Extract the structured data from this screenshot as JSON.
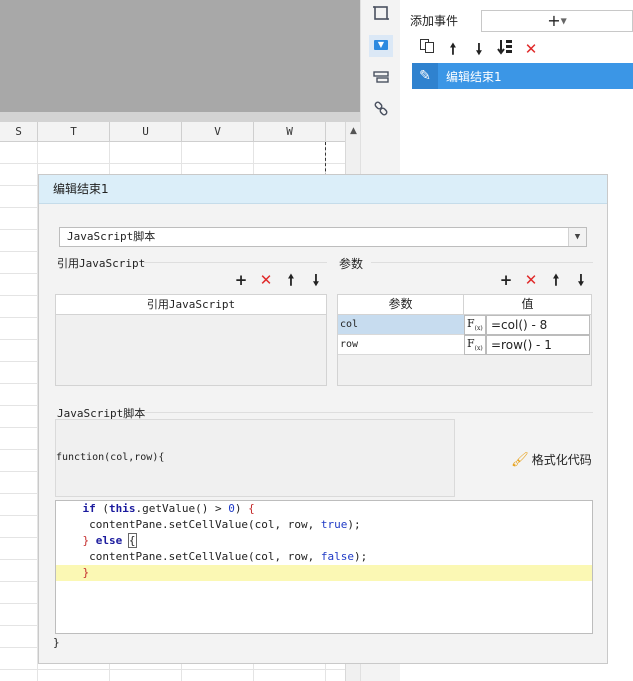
{
  "sheet": {
    "columns": [
      "S",
      "T",
      "U",
      "V",
      "W"
    ]
  },
  "event_panel": {
    "add_event_label": "添加事件",
    "add_button_label": "+",
    "tools": {
      "copy_icon": "copy-icon",
      "up_icon": "arrow-up-icon",
      "down_icon": "arrow-down-icon",
      "sort_icon": "sort-down-icon",
      "delete_icon": "delete-icon"
    },
    "items": [
      {
        "label": "编辑结束1"
      }
    ]
  },
  "dialog": {
    "title": "编辑结束1",
    "script_type": "JavaScript脚本",
    "ref_section_label": "引用JavaScript",
    "ref_column_header": "引用JavaScript",
    "params_section_label": "参数",
    "params_headers": {
      "name": "参数",
      "value": "值"
    },
    "params": [
      {
        "name": "col",
        "fx": "F",
        "value": "=col() - 8"
      },
      {
        "name": "row",
        "fx": "F",
        "value": "=row() - 1"
      }
    ],
    "js_section_label": "JavaScript脚本",
    "function_signature": "function(col,row){",
    "format_button": "格式化代码",
    "code_lines": [
      "    if (this.getValue() > 0) {",
      "     contentPane.setCellValue(col, row, true);",
      "    } else {",
      "     contentPane.setCellValue(col, row, false);",
      "    }"
    ],
    "closing_brace": "}"
  },
  "colors": {
    "accent": "#3b96e6",
    "dialog_title_bg": "#dbeef9",
    "delete_red": "#e02a2a",
    "highlight_line": "#fbf8b4"
  }
}
